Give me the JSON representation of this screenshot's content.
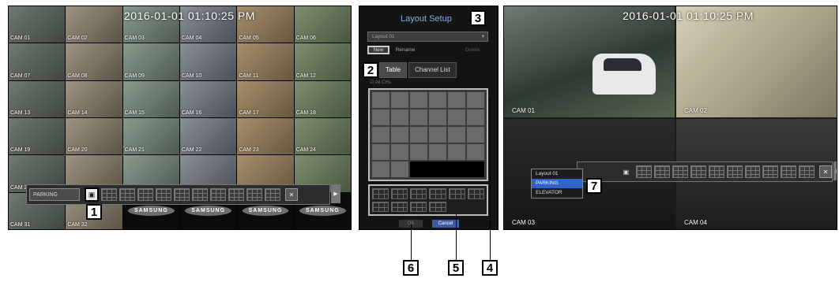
{
  "left_view": {
    "timestamp": "2016-01-01 01:10:25 PM",
    "cameras": [
      "CAM 01",
      "CAM 02",
      "CAM 03",
      "CAM 04",
      "CAM 05",
      "CAM 06",
      "CAM 07",
      "CAM 08",
      "CAM 09",
      "CAM 10",
      "CAM 11",
      "CAM 12",
      "CAM 13",
      "CAM 14",
      "CAM 15",
      "CAM 16",
      "CAM 17",
      "CAM 18",
      "CAM 19",
      "CAM 20",
      "CAM 21",
      "CAM 22",
      "CAM 23",
      "CAM 24",
      "CAM 25",
      "",
      "",
      "",
      "",
      "",
      "CAM 31",
      "CAM 32",
      "SAMSUNG",
      "SAMSUNG",
      "SAMSUNG",
      "SAMSUNG"
    ],
    "layout_bar": {
      "selected_layout": "PARKING"
    }
  },
  "layout_setup": {
    "title": "Layout Setup",
    "layout_dropdown": "Layout 01",
    "new_button": "New",
    "rename_button": "Rename",
    "delete_button": "Delete",
    "tabs": [
      "Table",
      "Channel List"
    ],
    "all_chs": "All CHs",
    "ok_button": "OK",
    "cancel_button": "Cancel"
  },
  "right_view": {
    "timestamp": "2016-01-01 01:10:25 PM",
    "cameras": [
      "CAM 01",
      "CAM 02",
      "CAM 03",
      "CAM 04"
    ],
    "layout_menu": [
      "Layout 01",
      "PARKING",
      "ELEVATOR"
    ],
    "layout_menu_selected": "PARKING"
  },
  "callouts": [
    "1",
    "2",
    "3",
    "4",
    "5",
    "6",
    "7"
  ],
  "colors": {
    "accent": "#2e63c9",
    "dialog_title": "#8ab0d8",
    "cancel": "#3b5ca0"
  }
}
